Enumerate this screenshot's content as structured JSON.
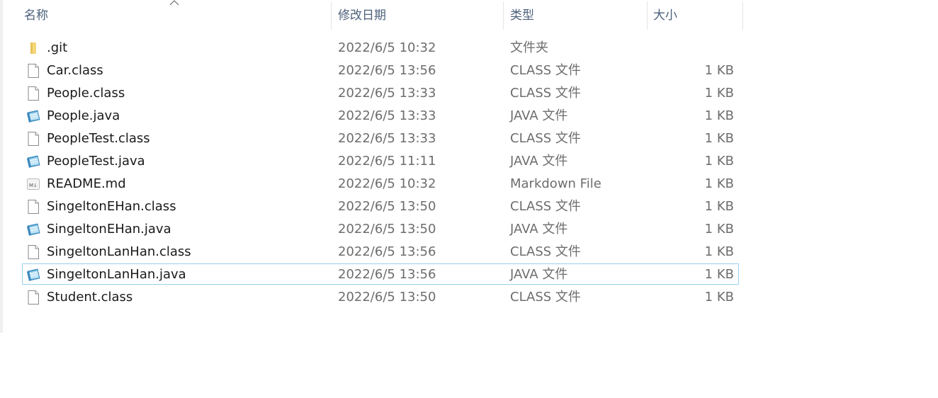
{
  "columns": {
    "name": "名称",
    "date": "修改日期",
    "type": "类型",
    "size": "大小"
  },
  "files": [
    {
      "name": ".git",
      "date": "2022/6/5 10:32",
      "type": "文件夹",
      "size": "",
      "icon": "folder-icon"
    },
    {
      "name": "Car.class",
      "date": "2022/6/5 13:56",
      "type": "CLASS 文件",
      "size": "1 KB",
      "icon": "file-icon"
    },
    {
      "name": "People.class",
      "date": "2022/6/5 13:33",
      "type": "CLASS 文件",
      "size": "1 KB",
      "icon": "file-icon"
    },
    {
      "name": "People.java",
      "date": "2022/6/5 13:33",
      "type": "JAVA 文件",
      "size": "1 KB",
      "icon": "java-file-icon"
    },
    {
      "name": "PeopleTest.class",
      "date": "2022/6/5 13:33",
      "type": "CLASS 文件",
      "size": "1 KB",
      "icon": "file-icon"
    },
    {
      "name": "PeopleTest.java",
      "date": "2022/6/5 11:11",
      "type": "JAVA 文件",
      "size": "1 KB",
      "icon": "java-file-icon"
    },
    {
      "name": "README.md",
      "date": "2022/6/5 10:32",
      "type": "Markdown File",
      "size": "1 KB",
      "icon": "markdown-file-icon"
    },
    {
      "name": "SingeltonEHan.class",
      "date": "2022/6/5 13:50",
      "type": "CLASS 文件",
      "size": "1 KB",
      "icon": "file-icon"
    },
    {
      "name": "SingeltonEHan.java",
      "date": "2022/6/5 13:50",
      "type": "JAVA 文件",
      "size": "1 KB",
      "icon": "java-file-icon"
    },
    {
      "name": "SingeltonLanHan.class",
      "date": "2022/6/5 13:56",
      "type": "CLASS 文件",
      "size": "1 KB",
      "icon": "file-icon"
    },
    {
      "name": "SingeltonLanHan.java",
      "date": "2022/6/5 13:56",
      "type": "JAVA 文件",
      "size": "1 KB",
      "icon": "java-file-icon",
      "selected": true
    },
    {
      "name": "Student.class",
      "date": "2022/6/5 13:50",
      "type": "CLASS 文件",
      "size": "1 KB",
      "icon": "file-icon"
    }
  ],
  "colors": {
    "header_text": "#4c607a",
    "name_text": "#1a1a1a",
    "detail_text": "#6d6d6d",
    "selection_border": "#99d1ee",
    "folder": "#f5d77a"
  }
}
